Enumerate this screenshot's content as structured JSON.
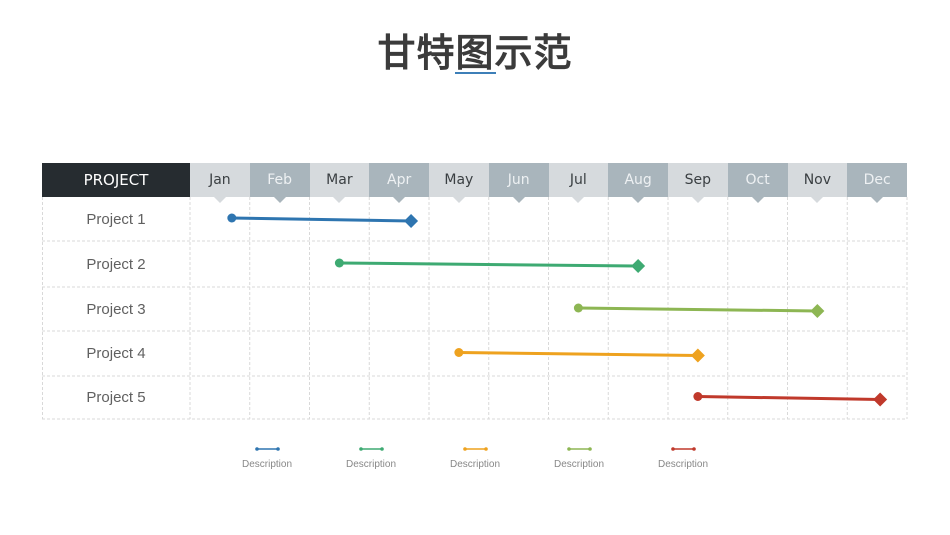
{
  "title": "甘特图示范",
  "accent_color": "#3d7fb8",
  "chart_data": {
    "type": "gantt",
    "title": "甘特图示范",
    "header_label": "PROJECT",
    "months": [
      "Jan",
      "Feb",
      "Mar",
      "Apr",
      "May",
      "Jun",
      "Jul",
      "Aug",
      "Sep",
      "Oct",
      "Nov",
      "Dec"
    ],
    "tasks": [
      {
        "name": "Project 1",
        "start": 0.7,
        "end": 3.7,
        "color": "#2e75b0"
      },
      {
        "name": "Project 2",
        "start": 2.5,
        "end": 7.5,
        "color": "#3eaa72"
      },
      {
        "name": "Project 3",
        "start": 6.5,
        "end": 10.5,
        "color": "#8db653"
      },
      {
        "name": "Project 4",
        "start": 4.5,
        "end": 8.5,
        "color": "#eea21f"
      },
      {
        "name": "Project 5",
        "start": 8.5,
        "end": 11.55,
        "color": "#c0392b"
      }
    ],
    "legend": [
      {
        "label": "Description",
        "color": "#2e75b0"
      },
      {
        "label": "Description",
        "color": "#3eaa72"
      },
      {
        "label": "Description",
        "color": "#eea21f"
      },
      {
        "label": "Description",
        "color": "#8db653"
      },
      {
        "label": "Description",
        "color": "#c0392b"
      }
    ]
  }
}
